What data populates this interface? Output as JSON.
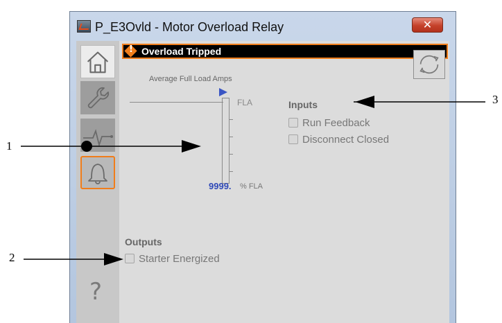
{
  "window": {
    "title": "P_E3Ovld - Motor Overload Relay",
    "close_glyph": "✕"
  },
  "sidebar": {
    "items": [
      {
        "name": "home",
        "icon": "home-icon"
      },
      {
        "name": "maintenance",
        "icon": "wrench-icon"
      },
      {
        "name": "trends",
        "icon": "trend-icon"
      },
      {
        "name": "alarms",
        "icon": "bell-icon",
        "selected": true
      },
      {
        "name": "help",
        "icon": "help-icon",
        "label": "?"
      }
    ]
  },
  "alarm": {
    "text": "Overload Tripped",
    "indicator_mark": "!",
    "color": "#f07d1a"
  },
  "gauge": {
    "caption": "Average Full Load Amps",
    "fla_label": "FLA",
    "value": "9999.",
    "unit": "% FLA",
    "marker_color": "#3a55c4"
  },
  "inputs": {
    "header": "Inputs",
    "items": [
      {
        "label": "Run Feedback",
        "checked": false
      },
      {
        "label": "Disconnect Closed",
        "checked": false
      }
    ]
  },
  "outputs": {
    "header": "Outputs",
    "items": [
      {
        "label": "Starter Energized",
        "checked": false
      }
    ]
  },
  "callouts": [
    {
      "number": "1"
    },
    {
      "number": "2"
    },
    {
      "number": "3"
    }
  ]
}
